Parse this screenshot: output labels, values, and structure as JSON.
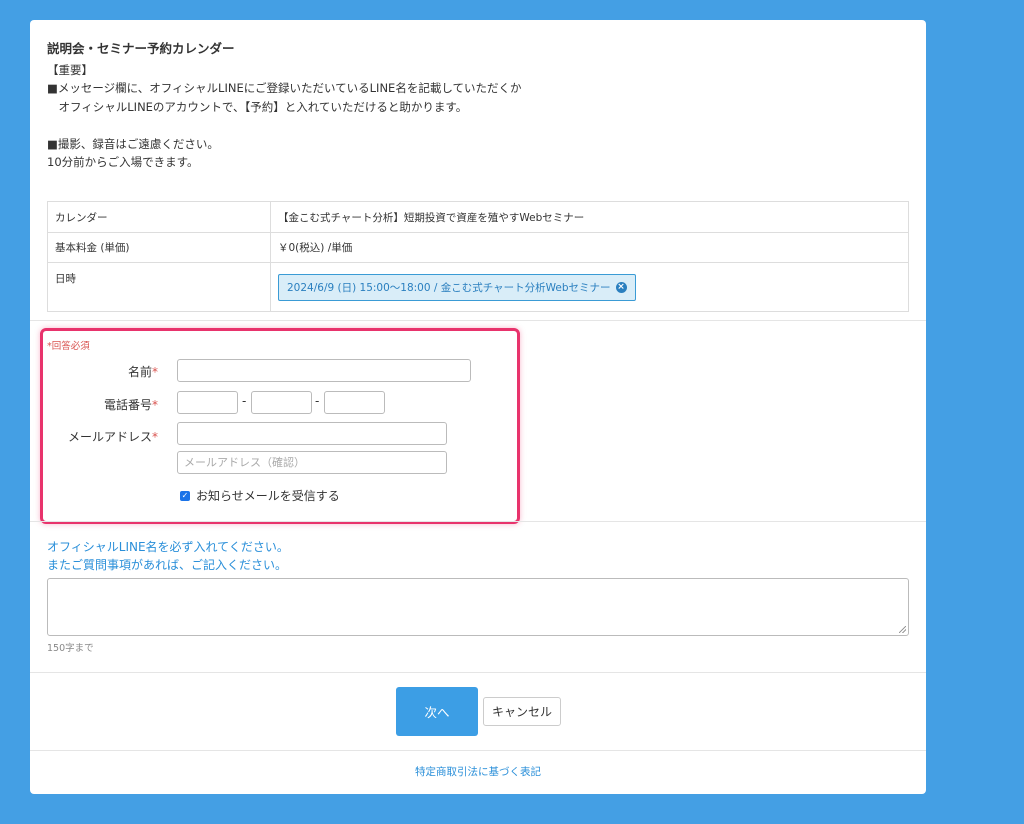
{
  "intro": {
    "title": "説明会・セミナー予約カレンダー",
    "lines": [
      "【重要】",
      "■メッセージ欄に、オフィシャルLINEにご登録いただいているLINE名を記載していただくか",
      "　オフィシャルLINEのアカウントで、【予約】と入れていただけると助かります。",
      "",
      "■撮影、録音はご遠慮ください。",
      "10分前からご入場できます。"
    ]
  },
  "info_table": {
    "calendar_label": "カレンダー",
    "calendar_value": "【金こむ式チャート分析】短期投資で資産を殖やすWebセミナー",
    "fee_label": "基本料金 (単価)",
    "fee_value": "￥0(税込) /単価",
    "datetime_label": "日時",
    "datetime_value": "2024/6/9 (日) 15:00〜18:00 / 金こむ式チャート分析Webセミナー"
  },
  "form": {
    "required_note": "*回答必須",
    "name_label": "名前",
    "phone_label": "電話番号",
    "phone_separator": "-",
    "email_label": "メールアドレス",
    "required_mark": "*",
    "email_confirm_placeholder": "メールアドレス（確認）",
    "newsletter_label": "お知らせメールを受信する",
    "newsletter_checked": true
  },
  "message": {
    "label_line1": "オフィシャルLINE名を必ず入れてください。",
    "label_line2": "またご質問事項があれば、ご記入ください。",
    "char_limit": "150字まで"
  },
  "actions": {
    "next_label": "次へ",
    "cancel_label": "キャンセル"
  },
  "footer": {
    "link_label": "特定商取引法に基づく表記"
  },
  "colors": {
    "background": "#449fe4",
    "accent": "#3c9ee5",
    "highlight_border": "#e8336c",
    "required": "#d9534f"
  }
}
